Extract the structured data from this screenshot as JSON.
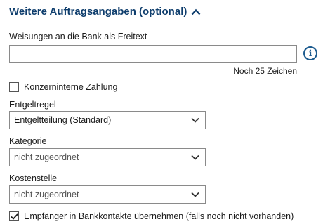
{
  "section": {
    "title": "Weitere Auftragsangaben (optional)"
  },
  "freetext": {
    "label": "Weisungen an die Bank als Freitext",
    "value": "",
    "counter": "Noch 25 Zeichen",
    "info_icon": "info-icon"
  },
  "intercompany": {
    "label": "Konzerninterne Zahlung",
    "checked": false
  },
  "fee_rule": {
    "label": "Entgeltregel",
    "value": "Entgeltteilung (Standard)"
  },
  "category": {
    "label": "Kategorie",
    "value": "nicht zugeordnet"
  },
  "cost_center": {
    "label": "Kostenstelle",
    "value": "nicht zugeordnet"
  },
  "save_contact": {
    "label": "Empfänger in Bankkontakte übernehmen (falls noch nicht vorhanden)",
    "checked": true
  },
  "colors": {
    "title": "#0f3e6d",
    "info": "#1c5b8f",
    "border": "#8a8a8a"
  }
}
